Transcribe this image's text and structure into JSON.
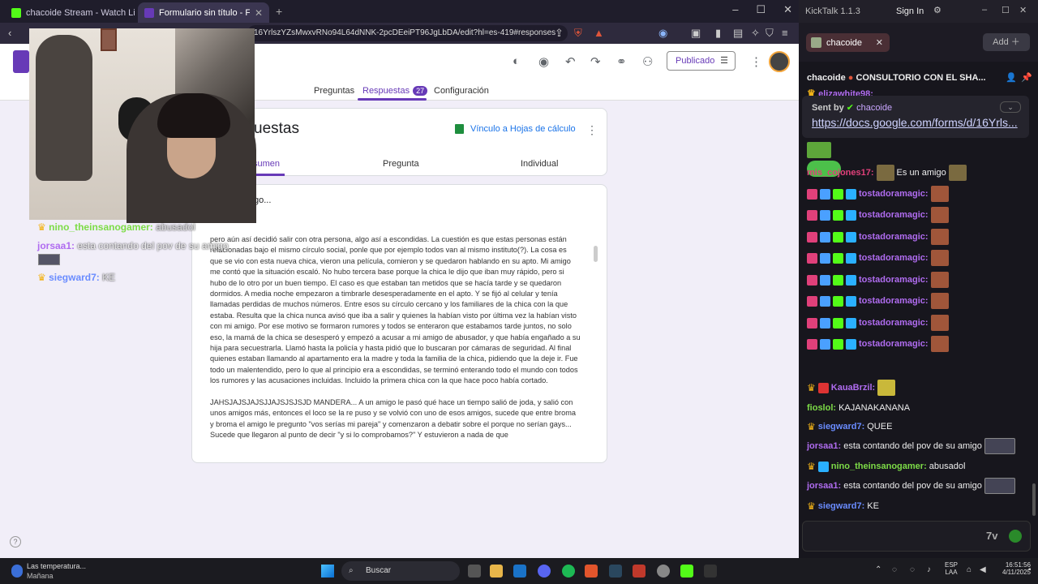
{
  "browser": {
    "tabs": [
      {
        "title": "chacoide Stream - Watch Live on"
      },
      {
        "title": "Formulario sin título - Formulario"
      }
    ],
    "url": "16YrlszYZsMwxvRNo94L64dNNK-2pcDEeiPT96JgLbDA/edit?hl=es-419#responses"
  },
  "forms": {
    "publish_label": "Publicado",
    "tabs": [
      {
        "label": "Preguntas"
      },
      {
        "label": "Respuestas",
        "badge": "27"
      },
      {
        "label": "Configuración"
      }
    ],
    "card_title": "uestas",
    "sheets_link": "Vínculo a Hojas de cálculo",
    "subtabs": [
      "sumen",
      "Pregunta",
      "Individual"
    ],
    "question_title": "go...",
    "response_paragraphs": [
      "pero aún así decidió salir con otra persona, algo así a escondidas. La cuestión es que estas personas están relacionadas bajo el mismo círculo social, ponle que por ejemplo todos van al mismo instituto(?). La cosa es que se vio con esta nueva chica, vieron una película, comieron y se quedaron hablando en su apto. Mi amigo me contó que la situación escaló. No hubo tercera base porque la chica le dijo que iban muy rápido, pero si hubo de lo otro por un buen tiempo. El caso es que estaban tan metidos que se hacía tarde y se quedaron dormidos. A media noche empezaron a timbrarle desesperadamente en el apto. Y se fijó al celular y tenía llamadas perdidas de muchos números. Entre esos su círculo cercano y los familiares de la chica con la que estaba. Resulta que la chica nunca avisó que iba a salir y quienes la habían visto por última vez la habían visto con mi amigo. Por ese motivo se formaron rumores y todos se enteraron que estabamos tarde juntos, no solo eso, la mamá de la chica se desesperó y empezó a acusar a mi amigo de abusador, y que había engañado a su hija para secuestrarla. Llamó hasta la policía y hasta pidió que lo buscaran por cámaras de seguridad. Al final quienes estaban llamando al apartamento era la madre y toda la familia de la chica, pidiendo que la deje ir. Fue todo un malentendido, pero lo que al principio era a escondidas, se terminó enterando todo el mundo con todos los rumores y las acusaciones incluidas. Incluido la primera chica con la que hace poco había cortado.",
      "JAHSJAJSJAJSJJAJSJSJSJD MANDERA... A un amigo le pasó qué hace un tiempo salió de joda, y salió con unos amigos más, entonces el loco se la re puso y se volvió con uno de esos amigos, sucede que entre broma y broma el amigo le pregunto \"vos serías mi pareja\" y comenzaron a debatir sobre el porque no serían gays... Sucede que llegaron al punto de decir \"y si lo comprobamos?\" Y estuvieron a nada de que"
    ]
  },
  "overlay_chat": [
    {
      "user": "nino_theinsanogamer:",
      "text": "abusadol",
      "color": "#7ddc47"
    },
    {
      "user": "jorsaa1:",
      "text": "esta contando del pov de su amigo",
      "color": "#b06cf0"
    },
    {
      "user": "siegward7:",
      "text": "KE",
      "color": "#6a8cff"
    }
  ],
  "kicktalk": {
    "app_title": "KickTalk 1.1.3",
    "sign_in": "Sign In",
    "channel_tab": "chacoide",
    "add_label": "Add",
    "channel_user": "chacoide",
    "channel_title": "CONSULTORIO CON EL SHA...",
    "pinned_sent_by": "Sent by",
    "pinned_user": "chacoide",
    "pinned_url": "https://docs.google.com/forms/d/16Yrls...",
    "partial_user": "elizawhite98:",
    "messages": [
      {
        "user": "mis_cojones17:",
        "text": "Es un amigo",
        "color": "#e0407a"
      },
      {
        "user": "tostadoramagic:",
        "text": "",
        "color": "#b06cf0"
      },
      {
        "user": "tostadoramagic:",
        "text": "",
        "color": "#b06cf0"
      },
      {
        "user": "tostadoramagic:",
        "text": "",
        "color": "#b06cf0"
      },
      {
        "user": "tostadoramagic:",
        "text": "",
        "color": "#b06cf0"
      },
      {
        "user": "tostadoramagic:",
        "text": "",
        "color": "#b06cf0"
      },
      {
        "user": "tostadoramagic:",
        "text": "",
        "color": "#b06cf0"
      },
      {
        "user": "tostadoramagic:",
        "text": "",
        "color": "#b06cf0"
      },
      {
        "user": "tostadoramagic:",
        "text": "",
        "color": "#b06cf0"
      },
      {
        "user": "KauaBrzil:",
        "text": "",
        "color": "#b06cf0"
      },
      {
        "user": "fioslol:",
        "text": "KAJANAKANANA",
        "color": "#7ddc47"
      },
      {
        "user": "siegward7:",
        "text": "QUEE",
        "color": "#6a8cff"
      },
      {
        "user": "jorsaa1:",
        "text": "esta contando del pov de su amigo",
        "color": "#b06cf0"
      },
      {
        "user": "nino_theinsanogamer:",
        "text": "abusadol",
        "color": "#7ddc47"
      },
      {
        "user": "jorsaa1:",
        "text": "esta contando del pov de su amigo",
        "color": "#b06cf0"
      },
      {
        "user": "siegward7:",
        "text": "KE",
        "color": "#6a8cff"
      }
    ]
  },
  "taskbar": {
    "weather_line1": "Las temperatura...",
    "weather_line2": "Mañana",
    "search_placeholder": "Buscar",
    "lang1": "ESP",
    "lang2": "LAA",
    "time": "16:51:56",
    "date": "4/11/2025"
  },
  "colors": {
    "forms_purple": "#673ab7",
    "kick_green": "#53fc18"
  }
}
